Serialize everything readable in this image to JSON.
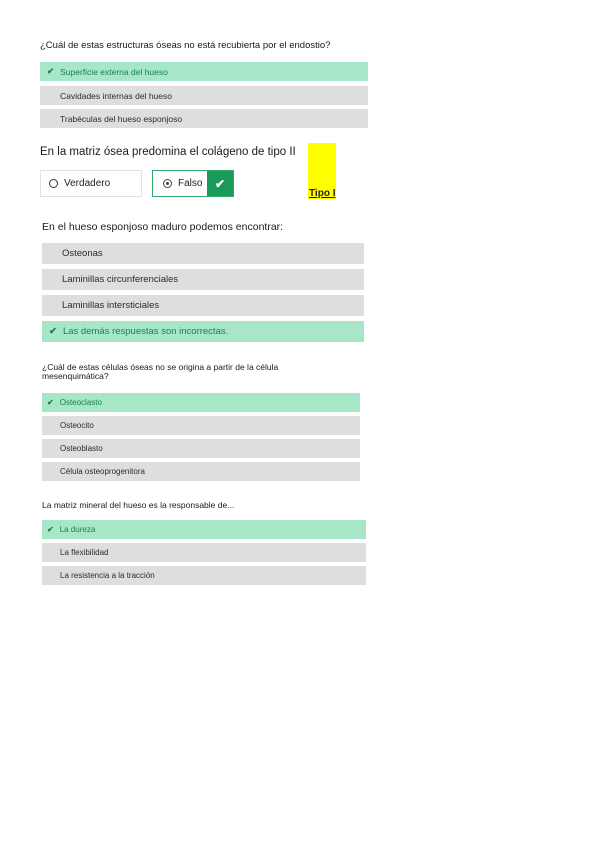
{
  "q1": {
    "question": "¿Cuál de estas estructuras óseas no está recubierta por el endostio?",
    "options": [
      {
        "label": "Superficie externa del hueso",
        "correct": true
      },
      {
        "label": "Cavidades internas del hueso",
        "correct": false
      },
      {
        "label": "Trabéculas del hueso esponjoso",
        "correct": false
      }
    ]
  },
  "q2": {
    "question": "En la matriz ósea predomina el colágeno de tipo II",
    "true_label": "Verdadero",
    "false_label": "Falso",
    "selected": "Falso",
    "note": "Tipo I",
    "note_color": "#ffff00"
  },
  "q3": {
    "question": "En el hueso esponjoso maduro podemos encontrar:",
    "options": [
      {
        "label": "Osteonas",
        "correct": false
      },
      {
        "label": "Laminillas circunferenciales",
        "correct": false
      },
      {
        "label": "Laminillas intersticiales",
        "correct": false
      },
      {
        "label": "Las demás respuestas son incorrectas.",
        "correct": true
      }
    ]
  },
  "q4": {
    "question": "¿Cuál de estas células óseas no se origina a partir de la célula mesenquimática?",
    "options": [
      {
        "label": "Osteoclasto",
        "correct": true
      },
      {
        "label": "Osteocito",
        "correct": false
      },
      {
        "label": "Osteoblasto",
        "correct": false
      },
      {
        "label": "Célula osteoprogenitora",
        "correct": false
      }
    ]
  },
  "q5": {
    "question": "La matriz mineral del hueso es la responsable de...",
    "options": [
      {
        "label": "La dureza",
        "correct": true
      },
      {
        "label": "La flexibilidad",
        "correct": false
      },
      {
        "label": "La resistencia a la tracción",
        "correct": false
      }
    ]
  },
  "colors": {
    "correct_bg": "#a8e6c8",
    "correct_text": "#16834f",
    "option_bg": "#dedede",
    "check_button": "#1a9a5a"
  }
}
